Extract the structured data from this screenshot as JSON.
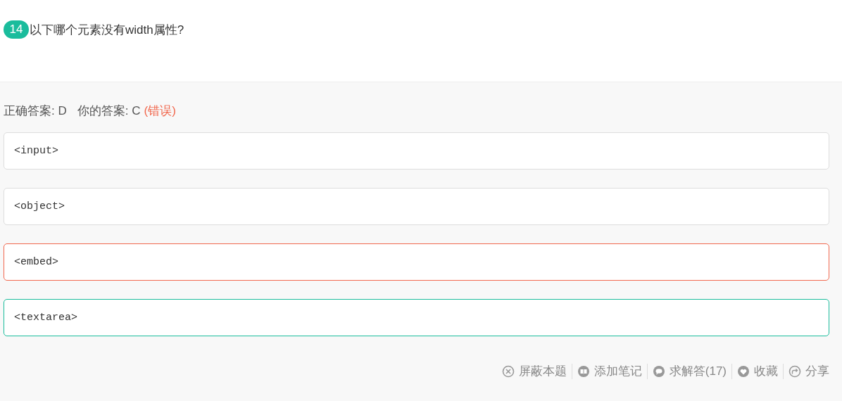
{
  "question": {
    "number": "14",
    "text": "以下哪个元素没有width属性?"
  },
  "result": {
    "correct_label": "正确答案: D",
    "yours_label": "你的答案: C",
    "verdict": "(错误)"
  },
  "options": [
    {
      "text": "<input>",
      "wrong": false,
      "correct": false
    },
    {
      "text": "<object>",
      "wrong": false,
      "correct": false
    },
    {
      "text": "<embed>",
      "wrong": true,
      "correct": false
    },
    {
      "text": "<textarea>",
      "wrong": false,
      "correct": true
    }
  ],
  "actions": [
    {
      "kind": "block",
      "label": "屏蔽本题"
    },
    {
      "kind": "note",
      "label": "添加笔记"
    },
    {
      "kind": "ask",
      "label": "求解答(17)"
    },
    {
      "kind": "favorite",
      "label": "收藏"
    },
    {
      "kind": "share",
      "label": "分享"
    }
  ]
}
